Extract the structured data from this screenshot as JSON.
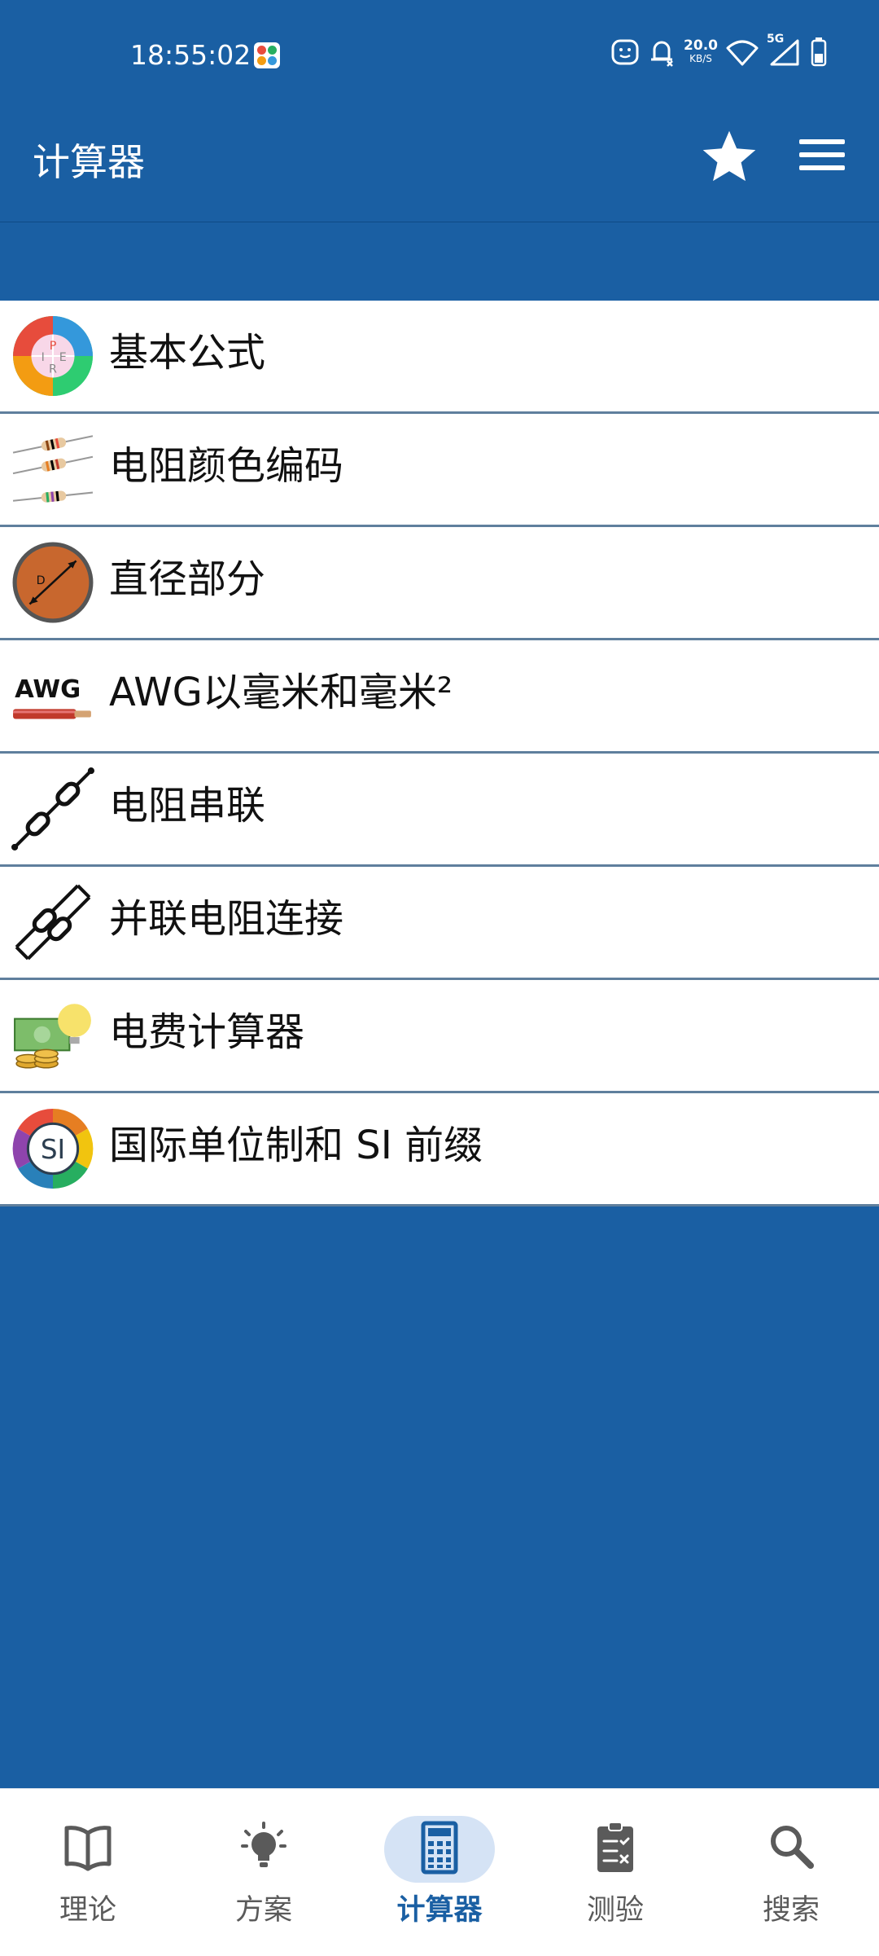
{
  "status_bar": {
    "time": "18:55:02",
    "net_speed": "20.0",
    "net_unit": "KB/S",
    "network": "5G"
  },
  "app_bar": {
    "title": "计算器"
  },
  "list": {
    "items": [
      {
        "label": "基本公式",
        "icon": "ohms-law-wheel-icon"
      },
      {
        "label": "电阻颜色编码",
        "icon": "resistor-color-code-icon"
      },
      {
        "label": "直径部分",
        "icon": "wire-diameter-icon"
      },
      {
        "label": "AWG以毫米和毫米²",
        "icon": "awg-wire-icon"
      },
      {
        "label": "电阻串联",
        "icon": "resistors-series-icon"
      },
      {
        "label": "并联电阻连接",
        "icon": "resistors-parallel-icon"
      },
      {
        "label": "电费计算器",
        "icon": "electricity-cost-icon"
      },
      {
        "label": "国际单位制和 SI 前缀",
        "icon": "si-units-icon"
      }
    ],
    "awg_badge": "AWG",
    "si_badge": "SI"
  },
  "bottom_nav": {
    "items": [
      {
        "label": "理论",
        "icon": "book-icon",
        "active": false
      },
      {
        "label": "方案",
        "icon": "lightbulb-icon",
        "active": false
      },
      {
        "label": "计算器",
        "icon": "calculator-icon",
        "active": true
      },
      {
        "label": "测验",
        "icon": "clipboard-quiz-icon",
        "active": false
      },
      {
        "label": "搜索",
        "icon": "search-icon",
        "active": false
      }
    ]
  },
  "colors": {
    "primary": "#1a5fa3",
    "nav_active": "#1a5fa3",
    "nav_active_bg": "#d5e3f5",
    "list_bg": "#ffffff",
    "list_divider": "#5f7f9d"
  }
}
